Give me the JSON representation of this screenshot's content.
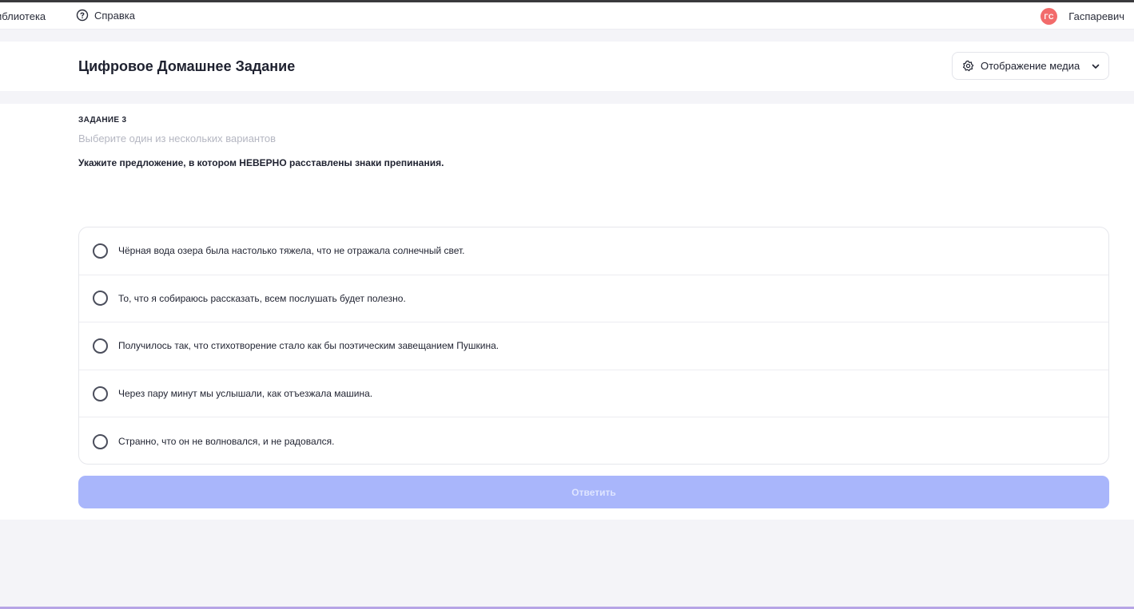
{
  "topbar": {
    "library_label": "иблиотека",
    "help_label": "Справка",
    "user": {
      "initials": "ГС",
      "name": "Гаспаревич",
      "avatar_color": "#f26b6b"
    }
  },
  "header": {
    "title": "Цифровое Домашнее Задание",
    "media_button_label": "Отображение медиа"
  },
  "task": {
    "label": "ЗАДАНИЕ 3",
    "hint": "Выберите один из нескольких вариантов",
    "question": "Укажите предложение, в котором НЕВЕРНО расставлены знаки препинания.",
    "options": [
      "Чёрная вода озера была настолько тяжела, что не отражала солнечный свет.",
      "То, что я собираюсь рассказать, всем послушать будет полезно.",
      "Получилось так, что стихотворение стало как бы поэтическим завещанием Пушкина.",
      "Через пару минут мы услышали, как отъезжала машина.",
      "Странно, что он не волновался, и не радовался."
    ],
    "submit_label": "Ответить"
  },
  "colors": {
    "accent_disabled": "#a9b6fb",
    "avatar": "#f26b6b"
  }
}
